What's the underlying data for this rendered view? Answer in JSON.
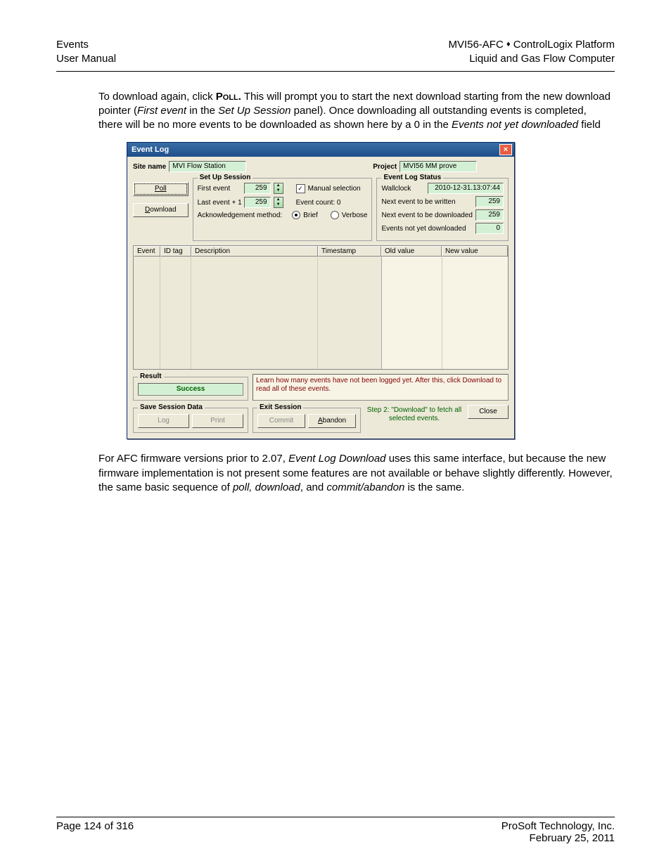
{
  "header": {
    "left1": "Events",
    "left2": "User Manual",
    "right1_a": "MVI56-AFC ",
    "right1_b": " ControlLogix Platform",
    "right2": "Liquid and Gas Flow Computer"
  },
  "para1_a": "To download again, click ",
  "para1_poll": "Poll.",
  "para1_b": " This will prompt you to start the next download starting from the new download pointer (",
  "para1_first": "First event",
  "para1_c": " in the ",
  "para1_setup": "Set Up Session",
  "para1_d": " panel). Once downloading all outstanding events is completed, there will be no more events to be downloaded as shown here by a 0 in the ",
  "para1_notyet": "Events not yet downloaded",
  "para1_e": " field",
  "dlg": {
    "title": "Event Log",
    "site_label": "Site name",
    "site_value": "MVI Flow Station",
    "project_label": "Project",
    "project_value": "MVI56 MM prove",
    "poll": "Poll",
    "download": "Download",
    "setup_legend": "Set Up Session",
    "first_event": "First event",
    "first_event_val": "259",
    "last_event": "Last event + 1",
    "last_event_val": "259",
    "manual_sel": "Manual selection",
    "event_count": "Event count: 0",
    "ack_method": "Acknowledgement method:",
    "brief": "Brief",
    "verbose": "Verbose",
    "status_legend": "Event Log Status",
    "wallclock": "Wallclock",
    "wallclock_val": "2010-12-31.13:07:44",
    "next_written": "Next event to be written",
    "next_written_val": "259",
    "next_dl": "Next event to be downloaded",
    "next_dl_val": "259",
    "not_yet": "Events not yet downloaded",
    "not_yet_val": "0",
    "cols": {
      "event": "Event",
      "idtag": "ID tag",
      "desc": "Description",
      "ts": "Timestamp",
      "old": "Old value",
      "new": "New value"
    },
    "result_legend": "Result",
    "result_val": "Success",
    "hint": "Learn how many events have not been logged yet.  After this, click Download to read all of these events.",
    "save_legend": "Save Session Data",
    "log_btn": "Log",
    "print_btn": "Print",
    "exit_legend": "Exit Session",
    "commit_btn": "Commit",
    "abandon_btn": "Abandon",
    "step2": "Step 2: \"Download\" to fetch all selected events.",
    "close_btn": "Close"
  },
  "para2_a": "For AFC firmware versions prior to 2.07, ",
  "para2_eld": "Event Log Download",
  "para2_b": " uses this same interface, but because the new firmware implementation is not present some features are not available or behave slightly differently.  However, the same basic sequence of ",
  "para2_pdl": "poll, download",
  "para2_c": ", and ",
  "para2_ca": "commit/abandon",
  "para2_d": " is the same.",
  "footer": {
    "page": "Page 124 of 316",
    "company": "ProSoft Technology, Inc.",
    "date": "February 25, 2011"
  }
}
